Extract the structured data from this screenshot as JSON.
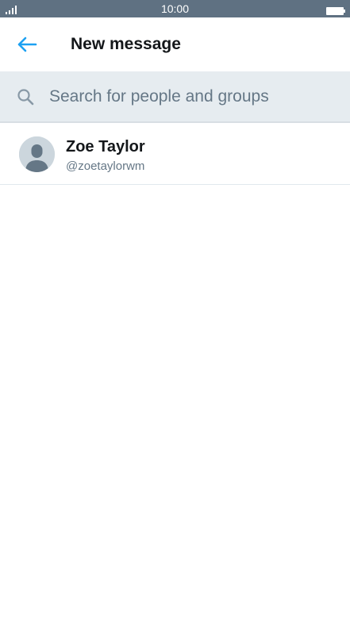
{
  "status_bar": {
    "time": "10:00",
    "signal_icon": "signal-icon",
    "battery_icon": "battery-icon"
  },
  "header": {
    "back_icon": "arrow-left-icon",
    "title": "New message"
  },
  "search": {
    "icon": "search-icon",
    "value": "",
    "placeholder": "Search for people and groups"
  },
  "results": [
    {
      "name": "Zoe Taylor",
      "handle": "@zoetaylorwm",
      "avatar_icon": "default-avatar-icon"
    }
  ],
  "colors": {
    "accent": "#1da1f2",
    "status_bar": "#5f7182",
    "search_background": "#e6ecf0",
    "primary_text": "#14171a",
    "secondary_text": "#657786"
  }
}
